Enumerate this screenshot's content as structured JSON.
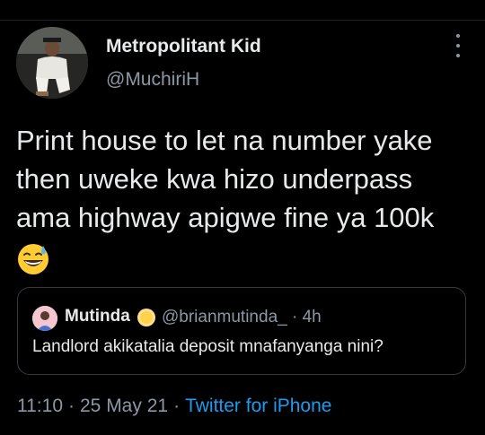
{
  "tweet": {
    "author_name": "Metropolitant Kid",
    "author_handle": "@MuchiriH",
    "text": "Print house to let na number yake then uweke kwa hizo underpass ama highway apigwe fine ya 100k",
    "emoji": "grinning-face-with-sweat",
    "time": "11:10",
    "date": "25 May 21",
    "separator": "·",
    "source": "Twitter for iPhone"
  },
  "quoted_tweet": {
    "name": "Mutinda",
    "badge_icon": "yellow-circle-emoji",
    "handle_time": "@brianmutinda_ · 4h",
    "text": "Landlord akikatalia deposit mnafanyanga nini?"
  },
  "colors": {
    "background": "#000000",
    "text_primary": "#e7e9ea",
    "text_secondary": "#8b98a5",
    "link": "#1d9bf0",
    "border": "#333a40"
  }
}
